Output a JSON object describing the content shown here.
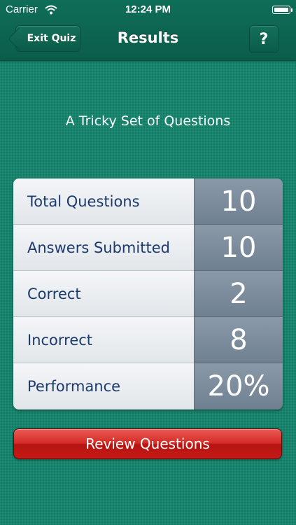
{
  "status_bar": {
    "carrier": "Carrier",
    "time": "12:24 PM"
  },
  "nav": {
    "back_label": "Exit Quiz",
    "title": "Results",
    "help_label": "?"
  },
  "quiz": {
    "title": "A Tricky Set of Questions"
  },
  "results": [
    {
      "label": "Total Questions",
      "value": "10"
    },
    {
      "label": "Answers Submitted",
      "value": "10"
    },
    {
      "label": "Correct",
      "value": "2"
    },
    {
      "label": "Incorrect",
      "value": "8"
    },
    {
      "label": "Performance",
      "value": "20%"
    }
  ],
  "actions": {
    "review_label": "Review Questions"
  },
  "colors": {
    "background": "#17856d",
    "nav_bar": "#0b5d4a",
    "label_text": "#1c3a6e",
    "review_button": "#d42b26"
  }
}
